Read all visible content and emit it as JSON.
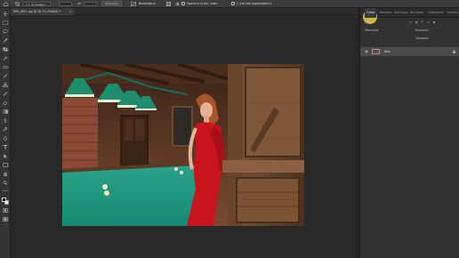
{
  "options_bar": {
    "mode_value": "1:1 (Стандарт...",
    "field_a": "",
    "field_b": "",
    "clear_label": "Очистить",
    "straighten_label": "Выпрямить",
    "delete_pixels_label": "Удалить отсеч. пикс.",
    "content_aware_label": "С учетом содержимого"
  },
  "document": {
    "tab_title": "IMG_9651.jpg @ 16,7% (RGB/8) *",
    "close_glyph": "×"
  },
  "panel": {
    "tabs": [
      "Слои",
      "Каналы",
      "Контуры",
      "История",
      "Описание",
      "Свойства"
    ],
    "active_tab": "Слои",
    "layer_name": "Фон",
    "kind_label": "Вид",
    "blend_label": "Обычные",
    "opacity_label": "Непрозр.:",
    "fill_label": "Заливка:"
  },
  "colors": {
    "foreground": "#000000",
    "background": "#ffffff",
    "cursor_highlight": "#ebcd46"
  },
  "icons": [
    "move-icon",
    "marquee-icon",
    "lasso-icon",
    "quick-select-icon",
    "crop-icon",
    "eyedropper-icon",
    "healing-icon",
    "brush-icon",
    "stamp-icon",
    "history-brush-icon",
    "eraser-icon",
    "gradient-icon",
    "blur-icon",
    "dodge-icon",
    "pen-icon",
    "type-icon",
    "path-select-icon",
    "shape-icon",
    "hand-icon",
    "zoom-icon",
    "more-tools-icon",
    "eye-icon",
    "lock-icon"
  ]
}
